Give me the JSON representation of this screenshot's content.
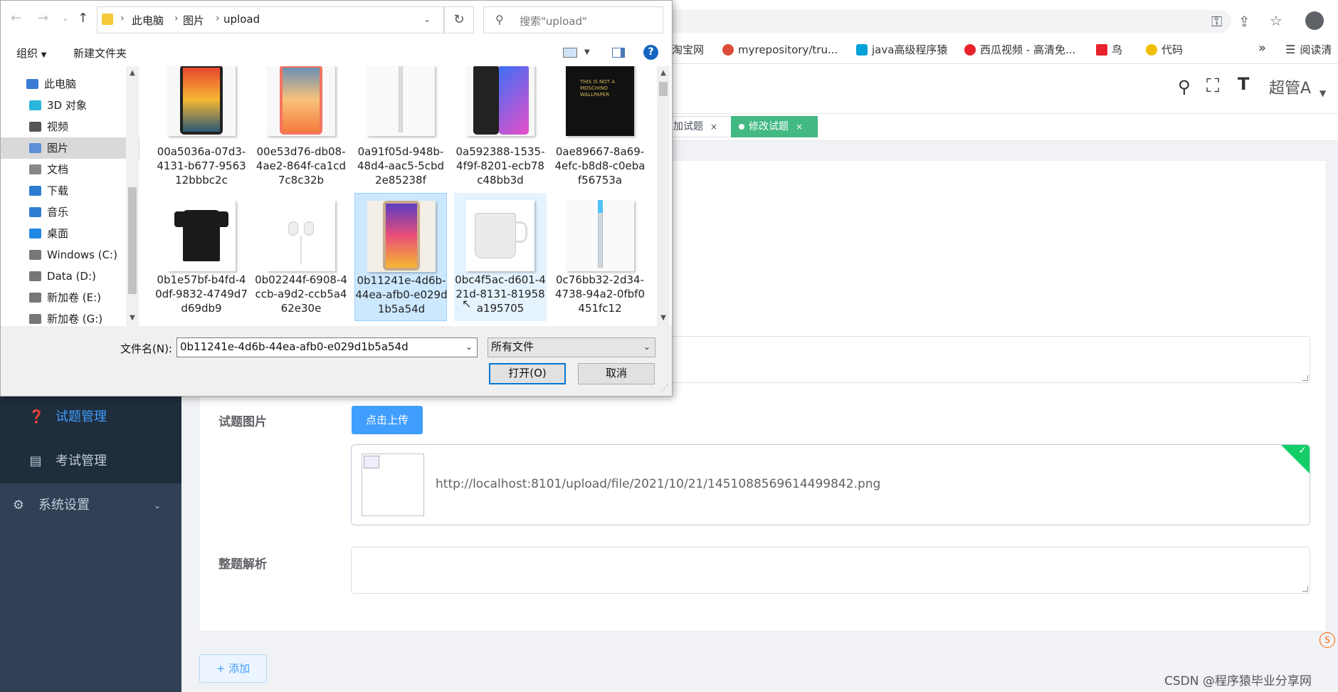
{
  "browser": {
    "bookmarks": [
      {
        "label": "淘宝网",
        "color": "#ff5000"
      },
      {
        "label": "myrepository/tru...",
        "color": "#dd4b39"
      },
      {
        "label": "java高级程序猿",
        "color": "#00a1d6"
      },
      {
        "label": "西瓜视频 - 高清免...",
        "color": "#e8222a"
      },
      {
        "label": "鸟",
        "color": "#e8222a"
      },
      {
        "label": "代码",
        "color": "#f0c000"
      }
    ],
    "more": "»",
    "reading_list": "阅读清"
  },
  "app": {
    "user_name": "超管A",
    "tags": [
      {
        "label": "加试题"
      },
      {
        "label": "修改试题"
      }
    ],
    "sidebar": {
      "items": [
        {
          "label": "试题管理",
          "icon": "question-circle-icon"
        },
        {
          "label": "考试管理",
          "icon": "list-icon"
        },
        {
          "label": "系统设置",
          "icon": "gear-icon"
        }
      ]
    },
    "form": {
      "image_label": "试题图片",
      "upload_button": "点击上传",
      "uploaded_url": "http://localhost:8101/upload/file/2021/10/21/1451088569614499842.png",
      "analysis_label": "整题解析",
      "add_button": "+ 添加"
    },
    "watermark": "CSDN @程序猿毕业分享网",
    "accent": "#409eff",
    "tag_active_color": "#42b983"
  },
  "dialog": {
    "breadcrumb": [
      "此电脑",
      "图片",
      "upload"
    ],
    "search_placeholder": "搜索\"upload\"",
    "toolbar": {
      "organize": "组织",
      "new_folder": "新建文件夹",
      "help": "?"
    },
    "nav_items": [
      {
        "label": "此电脑",
        "icon": "computer-icon",
        "color": "#3a7bd5"
      },
      {
        "label": "3D 对象",
        "icon": "cube-icon",
        "color": "#2bb5d9"
      },
      {
        "label": "视频",
        "icon": "video-icon",
        "color": "#555"
      },
      {
        "label": "图片",
        "icon": "picture-icon",
        "color": "#5b8fd6"
      },
      {
        "label": "文档",
        "icon": "document-icon",
        "color": "#888"
      },
      {
        "label": "下载",
        "icon": "download-icon",
        "color": "#2d7dd2"
      },
      {
        "label": "音乐",
        "icon": "music-icon",
        "color": "#2d7dd2"
      },
      {
        "label": "桌面",
        "icon": "desktop-icon",
        "color": "#1e88e5"
      },
      {
        "label": "Windows (C:)",
        "icon": "drive-icon",
        "color": "#777"
      },
      {
        "label": "Data (D:)",
        "icon": "drive-icon",
        "color": "#777"
      },
      {
        "label": "新加卷 (E:)",
        "icon": "drive-icon",
        "color": "#777"
      },
      {
        "label": "新加卷 (G:)",
        "icon": "drive-icon",
        "color": "#777"
      }
    ],
    "files": [
      {
        "name": "00a5036a-07d3-4131-b677-956312bbbc2c",
        "thumb": "phone-colorful"
      },
      {
        "name": "00e53d76-db08-4ae2-864f-ca1cd7c8c32b",
        "thumb": "phone-coral"
      },
      {
        "name": "0a91f05d-948b-48d4-aac5-5cbd2e85238f",
        "thumb": "pen"
      },
      {
        "name": "0a592388-1535-4f9f-8201-ecb78c48bb3d",
        "thumb": "phone-blue"
      },
      {
        "name": "0ae89667-8a69-4efc-b8d8-c0ebaf56753a",
        "thumb": "phone-black-text"
      },
      {
        "name": "0b1e57bf-b4fd-40df-9832-4749d7d69db9",
        "thumb": "shirt"
      },
      {
        "name": "0b02244f-6908-4ccb-a9d2-ccb5a462e30e",
        "thumb": "earphones"
      },
      {
        "name": "0b11241e-4d6b-44ea-afb0-e029d1b5a54d",
        "thumb": "phone-colorful"
      },
      {
        "name": "0bc4f5ac-d601-421d-8131-81958a195705",
        "thumb": "mug"
      },
      {
        "name": "0c76bb32-2d34-4738-94a2-0fbf0451fc12",
        "thumb": "pen-blue"
      }
    ],
    "filename_label": "文件名(N):",
    "filename_value": "0b11241e-4d6b-44ea-afb0-e029d1b5a54d",
    "filetype_value": "所有文件",
    "open_button": "打开(O)",
    "cancel_button": "取消"
  }
}
